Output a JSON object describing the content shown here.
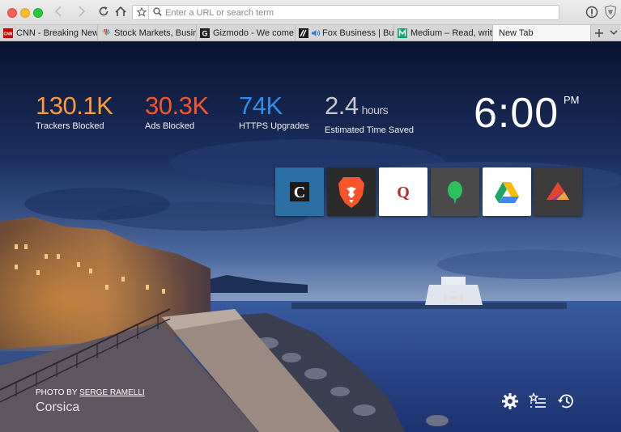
{
  "window": {
    "address_placeholder": "Enter a URL or search term"
  },
  "tabs": [
    {
      "label": "CNN - Breaking News,",
      "icon": "cnn-favicon"
    },
    {
      "label": "Stock Markets, Busine",
      "icon": "nbc-favicon"
    },
    {
      "label": "Gizmodo - We come fr",
      "icon": "gizmodo-favicon"
    },
    {
      "label": "Fox Business | Bus",
      "icon": "fox-business-favicon",
      "audio": true
    },
    {
      "label": "Medium – Read, write",
      "icon": "medium-favicon"
    },
    {
      "label": "New Tab",
      "active": true
    }
  ],
  "stats": [
    {
      "value": "130.1K",
      "label": "Trackers Blocked",
      "color": "#fe9a3b"
    },
    {
      "value": "30.3K",
      "label": "Ads Blocked",
      "color": "#fb542b"
    },
    {
      "value": "74K",
      "label": "HTTPS Upgrades",
      "color": "#2e8ce9"
    },
    {
      "value": "2.4",
      "unit": "hours",
      "label": "Estimated Time Saved",
      "color": "#c9c9c9"
    }
  ],
  "clock": {
    "time": "6:00",
    "ampm": "PM"
  },
  "top_sites": [
    {
      "name": "chicago-tribune",
      "bg": "#2c6fa3"
    },
    {
      "name": "brave",
      "bg": "#2b2b2b"
    },
    {
      "name": "quora",
      "bg": "#ffffff"
    },
    {
      "name": "evernote",
      "bg": "#4a4a4a"
    },
    {
      "name": "google-drive",
      "bg": "#ffffff"
    },
    {
      "name": "affinity",
      "bg": "#3c3c3c"
    }
  ],
  "photo": {
    "credit_prefix": "PHOTO BY ",
    "photographer": "SERGE RAMELLI",
    "location": "Corsica"
  }
}
